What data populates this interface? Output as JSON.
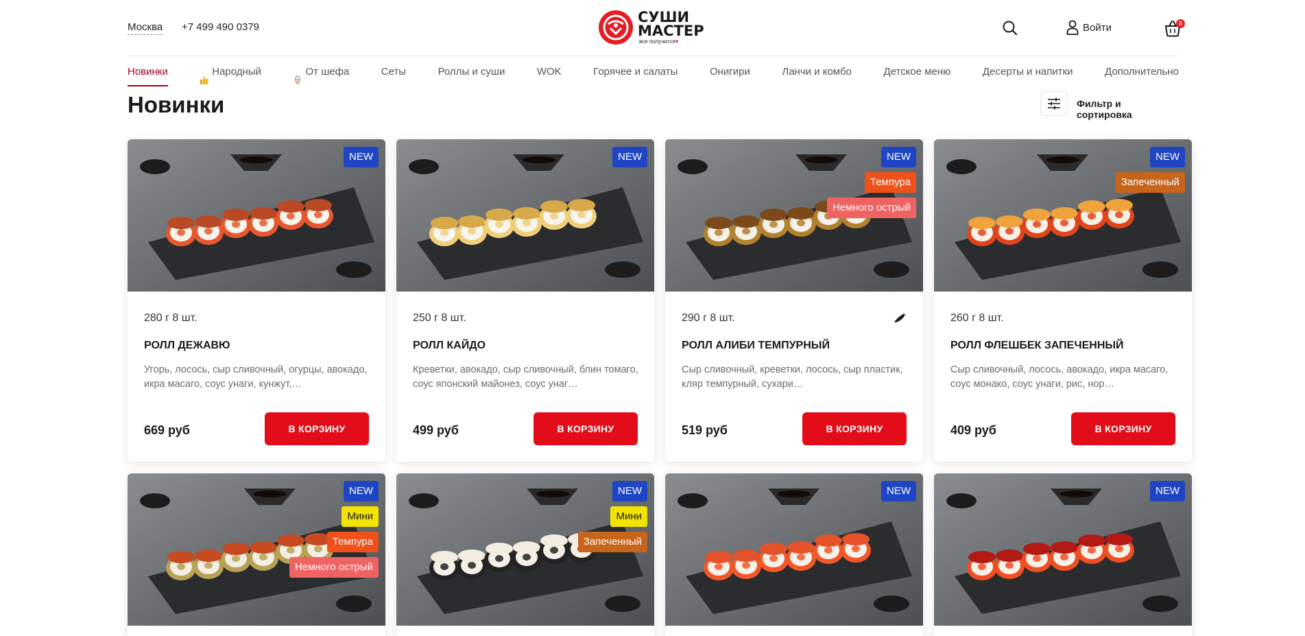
{
  "header": {
    "city": "Москва",
    "phone": "+7 499 490 0379",
    "logo_line1": "СУШИ",
    "logo_line2": "МАСТЕР",
    "logo_tagline": "все получится",
    "login_label": "Войти",
    "cart_count": "8",
    "brand_color": "#e31e24"
  },
  "nav": {
    "items": [
      {
        "label": "Новинки",
        "active": true
      },
      {
        "label": "Народный",
        "icon": "thumbs-up-icon"
      },
      {
        "label": "От шефа",
        "icon": "chef-icon"
      },
      {
        "label": "Сеты"
      },
      {
        "label": "Роллы и суши"
      },
      {
        "label": "WOK"
      },
      {
        "label": "Горячее и салаты"
      },
      {
        "label": "Онигири"
      },
      {
        "label": "Ланчи и комбо"
      },
      {
        "label": "Детское меню"
      },
      {
        "label": "Десерты и напитки"
      },
      {
        "label": "Дополнительно"
      }
    ]
  },
  "page": {
    "title": "Новинки",
    "filter_label": "Фильтр и сортировка"
  },
  "products": [
    {
      "weight": "280 г 8 шт.",
      "name": "РОЛЛ ДЕЖАВЮ",
      "description": "Угорь, лосось, сыр сливочный, огурцы, авокадо, икра масаго, соус унаги, кунжут,…",
      "price": "669 руб",
      "button": "В КОРЗИНУ",
      "tags": [
        {
          "label": "NEW",
          "kind": "new"
        }
      ]
    },
    {
      "weight": "250 г 8 шт.",
      "name": "РОЛЛ КАЙДО",
      "description": "Креветки, авокадо, сыр сливочный, блин томаго, соус японский майонез, соус унаг…",
      "price": "499 руб",
      "button": "В КОРЗИНУ",
      "tags": [
        {
          "label": "NEW",
          "kind": "new"
        }
      ]
    },
    {
      "weight": "290 г 8 шт.",
      "name": "РОЛЛ АЛИБИ ТЕМПУРНЫЙ",
      "description": "Сыр сливочный, креветки, лосось, сыр пластик, кляр темпурный, сухари…",
      "price": "519 руб",
      "button": "В КОРЗИНУ",
      "spicy": true,
      "tags": [
        {
          "label": "NEW",
          "kind": "new"
        },
        {
          "label": "Темпура",
          "kind": "tempura"
        },
        {
          "label": "Немного острый",
          "kind": "spicy"
        }
      ]
    },
    {
      "weight": "260 г 8 шт.",
      "name": "РОЛЛ ФЛЕШБЕК ЗАПЕЧЕННЫЙ",
      "description": "Сыр сливочный, лосось, авокадо, икра масаго, соус монако, соус унаги, рис, нор…",
      "price": "409 руб",
      "button": "В КОРЗИНУ",
      "tags": [
        {
          "label": "NEW",
          "kind": "new"
        },
        {
          "label": "Запеченный",
          "kind": "baked"
        }
      ]
    },
    {
      "tags": [
        {
          "label": "NEW",
          "kind": "new"
        },
        {
          "label": "Мини",
          "kind": "mini"
        },
        {
          "label": "Темпура",
          "kind": "tempura"
        },
        {
          "label": "Немного острый",
          "kind": "spicy"
        }
      ]
    },
    {
      "tags": [
        {
          "label": "NEW",
          "kind": "new"
        },
        {
          "label": "Мини",
          "kind": "mini"
        },
        {
          "label": "Запеченный",
          "kind": "baked"
        }
      ]
    },
    {
      "tags": [
        {
          "label": "NEW",
          "kind": "new"
        }
      ]
    },
    {
      "tags": [
        {
          "label": "NEW",
          "kind": "new"
        }
      ]
    }
  ]
}
